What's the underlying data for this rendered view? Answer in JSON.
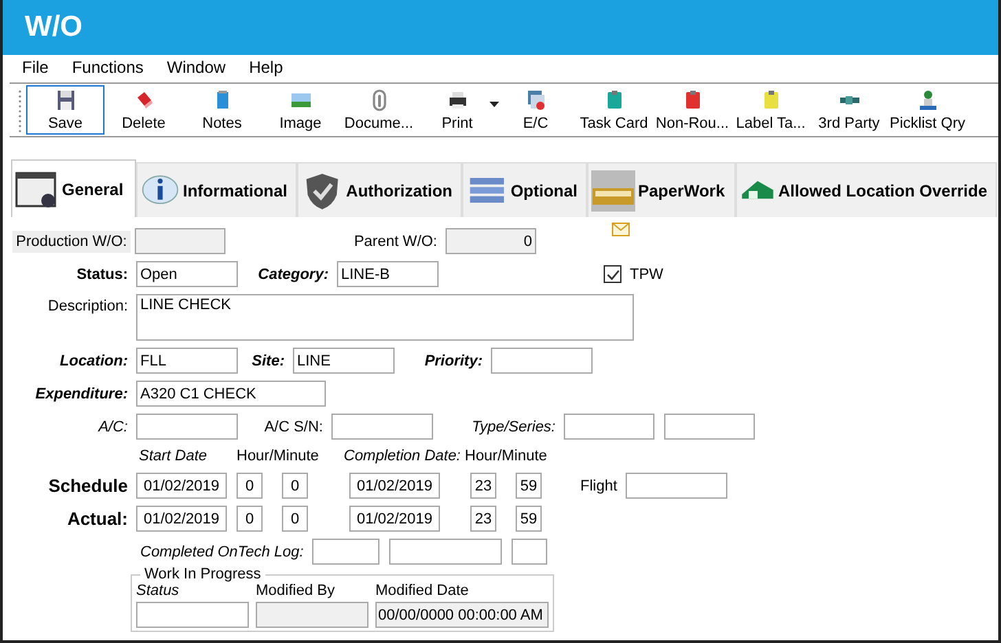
{
  "window": {
    "title": "W/O"
  },
  "menu": [
    "File",
    "Functions",
    "Window",
    "Help"
  ],
  "toolbar": [
    {
      "label": "Save",
      "selected": true,
      "dropdown": false
    },
    {
      "label": "Delete",
      "selected": false,
      "dropdown": false
    },
    {
      "label": "Notes",
      "selected": false,
      "dropdown": false
    },
    {
      "label": "Image",
      "selected": false,
      "dropdown": false
    },
    {
      "label": "Docume...",
      "selected": false,
      "dropdown": false
    },
    {
      "label": "Print",
      "selected": false,
      "dropdown": true
    },
    {
      "label": "E/C",
      "selected": false,
      "dropdown": false
    },
    {
      "label": "Task Card",
      "selected": false,
      "dropdown": false
    },
    {
      "label": "Non-Rou...",
      "selected": false,
      "dropdown": false
    },
    {
      "label": "Label Ta...",
      "selected": false,
      "dropdown": false
    },
    {
      "label": "3rd Party",
      "selected": false,
      "dropdown": false
    },
    {
      "label": "Picklist Qry",
      "selected": false,
      "dropdown": false
    }
  ],
  "tabs": [
    {
      "label": "General",
      "selected": true
    },
    {
      "label": "Informational",
      "selected": false
    },
    {
      "label": "Authorization",
      "selected": false
    },
    {
      "label": "Optional",
      "selected": false
    },
    {
      "label": "PaperWork",
      "selected": false
    },
    {
      "label": "Allowed Location Override",
      "selected": false
    }
  ],
  "form": {
    "production_wo": {
      "label": "Production W/O:",
      "disabled": true
    },
    "parent_wo": {
      "label": "Parent W/O:",
      "value": "0",
      "disabled": true
    },
    "status": {
      "label": "Status:",
      "value": "Open"
    },
    "category": {
      "label": "Category:",
      "value": "LINE-B"
    },
    "tpw": {
      "label": "TPW",
      "checked": true
    },
    "description": {
      "label": "Description:",
      "value": "LINE CHECK"
    },
    "location": {
      "label": "Location:",
      "value": "FLL"
    },
    "site": {
      "label": "Site:",
      "value": "LINE"
    },
    "priority": {
      "label": "Priority:"
    },
    "expenditure": {
      "label": "Expenditure:",
      "value": "A320 C1 CHECK"
    },
    "ac": {
      "label": "A/C:"
    },
    "ac_sn": {
      "label": "A/C S/N:"
    },
    "type_series": {
      "label": "Type/Series:"
    },
    "date_headers": [
      "Start Date",
      "Hour/Minute",
      "Completion Date:",
      "Hour/Minute"
    ],
    "schedule_rows": [
      {
        "label": "Schedule",
        "start_date": "01/02/2019",
        "start_hour": "0",
        "start_minute": "0",
        "completion_date": "01/02/2019",
        "completion_hour": "23",
        "completion_minute": "59"
      },
      {
        "label": "Actual:",
        "start_date": "01/02/2019",
        "start_hour": "0",
        "start_minute": "0",
        "completion_date": "01/02/2019",
        "completion_hour": "23",
        "completion_minute": "59"
      }
    ],
    "flight": {
      "label": "Flight"
    },
    "ontech_log": {
      "label": "Completed OnTech Log:"
    },
    "work_in_progress": {
      "title": "Work In Progress",
      "status": {
        "label": "Status"
      },
      "modified_by": {
        "label": "Modified By",
        "disabled": true
      },
      "modified_date": {
        "label": "Modified Date",
        "value": "00/00/0000 00:00:00 AM",
        "disabled": true
      }
    }
  }
}
